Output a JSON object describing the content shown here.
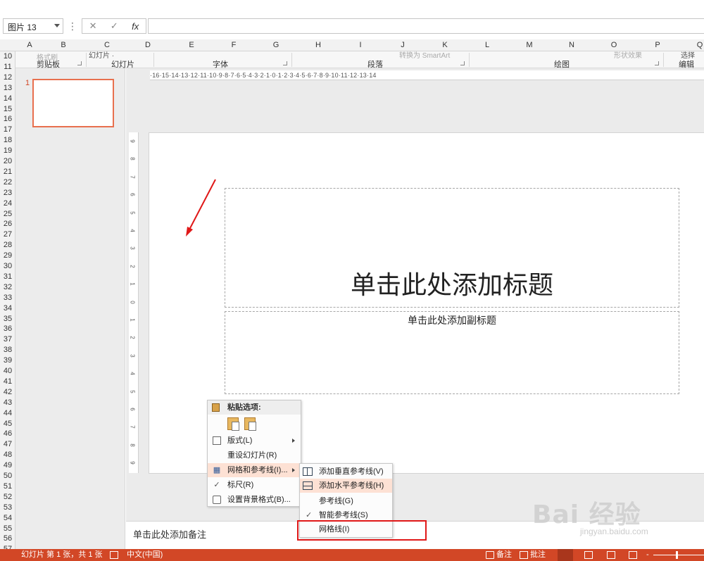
{
  "formula_bar": {
    "name_box": "图片 13",
    "more": "⋮",
    "cancel": "✕",
    "enter": "✓",
    "fx": "fx",
    "value": ""
  },
  "columns": [
    "A",
    "B",
    "C",
    "D",
    "E",
    "F",
    "G",
    "H",
    "I",
    "J",
    "K",
    "L",
    "M",
    "N",
    "O",
    "P",
    "Q"
  ],
  "rows": [
    "10",
    "11",
    "12",
    "13",
    "14",
    "15",
    "16",
    "17",
    "18",
    "19",
    "20",
    "21",
    "22",
    "23",
    "24",
    "25",
    "26",
    "27",
    "28",
    "29",
    "30",
    "31",
    "32",
    "33",
    "34",
    "35",
    "36",
    "37",
    "38",
    "39",
    "40",
    "41",
    "42",
    "43",
    "44",
    "45",
    "46",
    "47",
    "48",
    "49",
    "50",
    "51",
    "52",
    "53",
    "54",
    "55",
    "56",
    "57"
  ],
  "ribbon": {
    "groups": [
      "剪贴板",
      "幻灯片",
      "字体",
      "段落",
      "绘图",
      "编辑"
    ],
    "partial_labels": [
      "格式刷",
      "幻灯片 ·",
      "转换为 SmartArt",
      "形状效果",
      "选择"
    ]
  },
  "ruler_text": "·16·15·14·13·12·11·10·9·8·7·6·5·4·3·2·1·0·1·2·3·4·5·6·7·8·9·10·11·12·13·14",
  "vruler_ticks": [
    "9",
    "8",
    "7",
    "6",
    "5",
    "4",
    "3",
    "2",
    "1",
    "0",
    "1",
    "2",
    "3",
    "4",
    "5",
    "6",
    "7",
    "8",
    "9"
  ],
  "thumbnail": {
    "number": "1"
  },
  "slide": {
    "title_placeholder": "单击此处添加标题",
    "subtitle_placeholder": "单击此处添加副标题"
  },
  "notes_placeholder": "单击此处添加备注",
  "context_menu": {
    "paste_header": "粘贴选项:",
    "items": [
      {
        "label": "版式(L)",
        "icon": "layout-icon"
      },
      {
        "label": "重设幻灯片(R)",
        "icon": ""
      },
      {
        "label": "网格和参考线(I)...",
        "icon": "grid-icon"
      },
      {
        "label": "标尺(R)",
        "icon": "check-icon"
      },
      {
        "label": "设置背景格式(B)...",
        "icon": "background-icon"
      }
    ]
  },
  "submenu": {
    "items": [
      {
        "label": "添加垂直参考线(V)"
      },
      {
        "label": "添加水平参考线(H)"
      },
      {
        "label": "参考线(G)"
      },
      {
        "label": "智能参考线(S)"
      },
      {
        "label": "网格线(I)"
      }
    ]
  },
  "status": {
    "slide_info": "幻灯片 第 1 张，共 1 张",
    "language": "中文(中国)",
    "notes": "备注",
    "comments": "批注"
  },
  "watermark": {
    "main": "Bai 经验",
    "sub": "jingyan.baidu.com"
  },
  "colors": {
    "accent": "#d24726",
    "annotation": "#e01818",
    "highlight": "#fde1d4"
  }
}
